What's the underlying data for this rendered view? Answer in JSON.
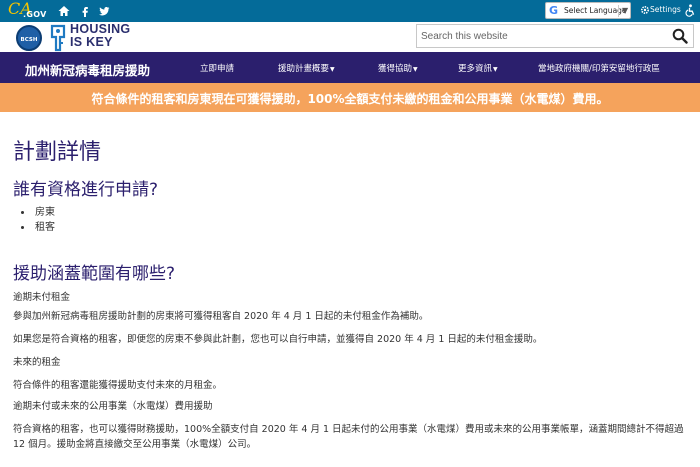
{
  "utility_bar": {
    "logo_text_ca": "CA",
    "logo_text_gov": ".GOV",
    "icons": [
      "home-icon",
      "facebook-icon",
      "twitter-icon"
    ],
    "language_label": "Select Language",
    "settings_label": "Settings"
  },
  "header": {
    "seal_text": "BCSH",
    "brand_line1": "HOUSING",
    "brand_line2": "IS KEY",
    "search_placeholder": "Search this website"
  },
  "nav": {
    "site_title": "加州新冠病毒租房援助",
    "items": [
      {
        "label": "立即申請",
        "has_menu": false
      },
      {
        "label": "援助計畫概要",
        "has_menu": true
      },
      {
        "label": "獲得協助",
        "has_menu": true
      },
      {
        "label": "更多資訊",
        "has_menu": true
      },
      {
        "label": "當地政府機關/印第安留地行政區",
        "has_menu": false
      }
    ]
  },
  "banner": {
    "text": "符合條件的租客和房東現在可獲得援助，100%全額支付未繳的租金和公用事業（水電煤）費用。"
  },
  "content": {
    "title": "計劃詳情",
    "eligibility_heading": "誰有資格進行申請?",
    "eligibility_list": [
      "房東",
      "租客"
    ],
    "coverage_heading": "援助涵蓋範圍有哪些?",
    "past_rent_label": "逾期未付租金",
    "past_rent_p1": "參與加州新冠病毒租房援助計劃的房東將可獲得租客自 2020 年 4 月 1 日起的未付租金作為補助。",
    "past_rent_p2": "如果您是符合資格的租客，即便您的房東不參與此計劃，您也可以自行申請，並獲得自 2020 年 4 月 1 日起的未付租金援助。",
    "future_rent_label": "未來的租金",
    "future_rent_p": "符合條件的租客還能獲得援助支付未來的月租金。",
    "utilities_label": "逾期未付或未來的公用事業（水電煤）費用援助",
    "utilities_p": "符合資格的租客，也可以獲得財務援助，100%全額支付自 2020 年 4 月 1 日起未付的公用事業（水電煤）費用或未來的公用事業帳單，涵蓋期間總計不得超過 12 個月。援助金將直接繳交至公用事業（水電煤）公司。"
  },
  "colors": {
    "util_bar": "#046b99",
    "nav": "#2b1f6d",
    "banner": "#f5a35c",
    "heading": "#2b1f6d"
  }
}
